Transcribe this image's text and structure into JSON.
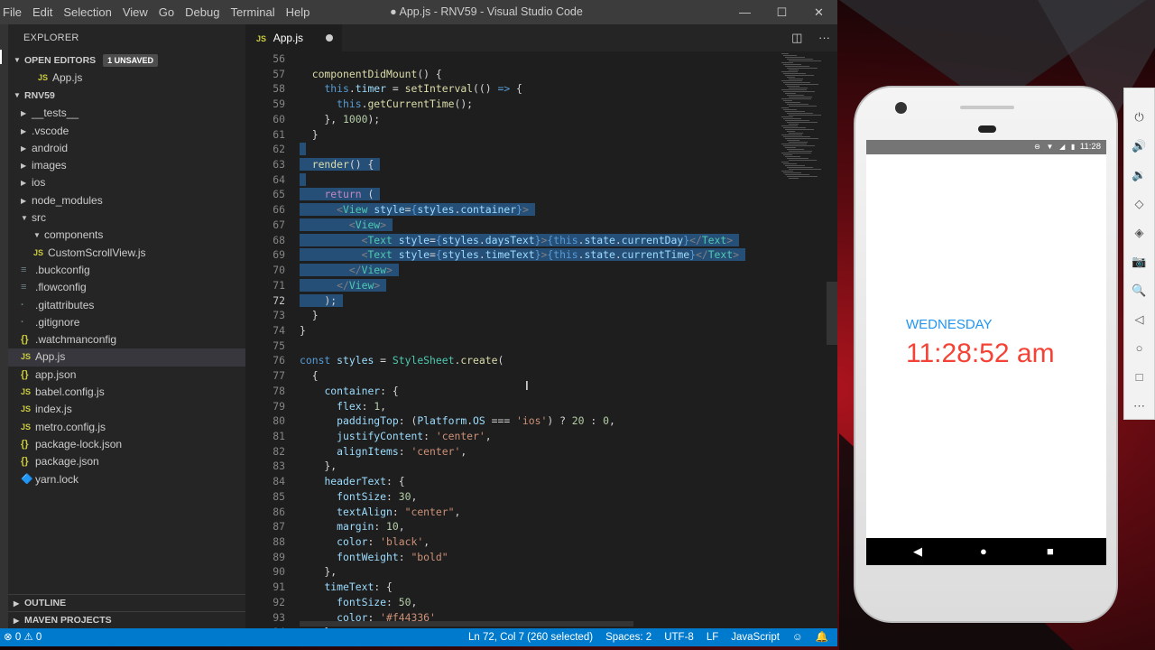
{
  "window": {
    "title": "● App.js - RNV59 - Visual Studio Code",
    "menu": [
      "File",
      "Edit",
      "Selection",
      "View",
      "Go",
      "Debug",
      "Terminal",
      "Help"
    ],
    "controls": [
      "—",
      "☐",
      "✕"
    ]
  },
  "sidebar": {
    "header": "EXPLORER",
    "open_editors": {
      "label": "OPEN EDITORS",
      "badge": "1 UNSAVED",
      "files": [
        {
          "icon": "JS",
          "name": "App.js"
        }
      ]
    },
    "project": {
      "label": "RNV59",
      "items": [
        {
          "type": "folder",
          "name": "__tests__",
          "depth": 1
        },
        {
          "type": "folder",
          "name": ".vscode",
          "depth": 1
        },
        {
          "type": "folder",
          "name": "android",
          "depth": 1
        },
        {
          "type": "folder",
          "name": "images",
          "depth": 1
        },
        {
          "type": "folder",
          "name": "ios",
          "depth": 1
        },
        {
          "type": "folder",
          "name": "node_modules",
          "depth": 1
        },
        {
          "type": "folder-open",
          "name": "src",
          "depth": 1
        },
        {
          "type": "folder-open",
          "name": "components",
          "depth": 2
        },
        {
          "type": "js",
          "icon": "JS",
          "name": "CustomScrollView.js",
          "depth": 3
        },
        {
          "type": "lines",
          "icon": "≡",
          "name": ".buckconfig",
          "depth": 1
        },
        {
          "type": "lines",
          "icon": "≡",
          "name": ".flowconfig",
          "depth": 1
        },
        {
          "type": "dot",
          "icon": "·",
          "name": ".gitattributes",
          "depth": 1
        },
        {
          "type": "dot",
          "icon": "·",
          "name": ".gitignore",
          "depth": 1
        },
        {
          "type": "json",
          "icon": "{}",
          "name": ".watchmanconfig",
          "depth": 1
        },
        {
          "type": "js",
          "icon": "JS",
          "name": "App.js",
          "depth": 1,
          "active": true
        },
        {
          "type": "json",
          "icon": "{}",
          "name": "app.json",
          "depth": 1
        },
        {
          "type": "js",
          "icon": "JS",
          "name": "babel.config.js",
          "depth": 1
        },
        {
          "type": "js",
          "icon": "JS",
          "name": "index.js",
          "depth": 1
        },
        {
          "type": "js",
          "icon": "JS",
          "name": "metro.config.js",
          "depth": 1
        },
        {
          "type": "json",
          "icon": "{}",
          "name": "package-lock.json",
          "depth": 1
        },
        {
          "type": "json",
          "icon": "{}",
          "name": "package.json",
          "depth": 1
        },
        {
          "type": "yarn",
          "icon": "🔷",
          "name": "yarn.lock",
          "depth": 1
        }
      ]
    },
    "bottom_sections": [
      "OUTLINE",
      "MAVEN PROJECTS"
    ]
  },
  "editor": {
    "tab": {
      "icon": "JS",
      "label": "App.js"
    },
    "line_numbers": [
      56,
      57,
      58,
      59,
      60,
      61,
      62,
      63,
      64,
      65,
      66,
      67,
      68,
      69,
      70,
      71,
      72,
      73,
      74,
      75,
      76,
      77,
      78,
      79,
      80,
      81,
      82,
      83,
      84,
      85,
      86,
      87,
      88,
      89,
      90,
      91,
      92,
      93,
      94
    ],
    "current_line": 72,
    "lines": [
      {
        "sel": false,
        "t": []
      },
      {
        "sel": false,
        "t": [
          [
            "",
            "  "
          ],
          [
            "fn",
            "componentDidMount"
          ],
          [
            "",
            "() {"
          ]
        ]
      },
      {
        "sel": false,
        "t": [
          [
            "",
            "    "
          ],
          [
            "kw",
            "this"
          ],
          [
            "",
            "."
          ],
          [
            "prop",
            "timer"
          ],
          [
            "",
            " = "
          ],
          [
            "fn",
            "setInterval"
          ],
          [
            "",
            "(() "
          ],
          [
            "kw",
            "=>"
          ],
          [
            "",
            " {"
          ]
        ]
      },
      {
        "sel": false,
        "t": [
          [
            "",
            "      "
          ],
          [
            "kw",
            "this"
          ],
          [
            "",
            "."
          ],
          [
            "fn",
            "getCurrentTime"
          ],
          [
            "",
            "();"
          ]
        ]
      },
      {
        "sel": false,
        "t": [
          [
            "",
            "    }, "
          ],
          [
            "num",
            "1000"
          ],
          [
            "",
            ");"
          ]
        ]
      },
      {
        "sel": false,
        "t": [
          [
            "",
            "  }"
          ]
        ]
      },
      {
        "sel": true,
        "t": [
          [
            "",
            ""
          ]
        ]
      },
      {
        "sel": true,
        "t": [
          [
            "",
            "  "
          ],
          [
            "fn",
            "render"
          ],
          [
            "",
            "() {"
          ]
        ]
      },
      {
        "sel": true,
        "t": [
          [
            "",
            ""
          ]
        ]
      },
      {
        "sel": true,
        "t": [
          [
            "",
            "    "
          ],
          [
            "ctl",
            "return"
          ],
          [
            "",
            " ("
          ]
        ]
      },
      {
        "sel": true,
        "t": [
          [
            "",
            "      "
          ],
          [
            "pun",
            "<"
          ],
          [
            "tag",
            "View"
          ],
          [
            "",
            " "
          ],
          [
            "prop",
            "style"
          ],
          [
            "",
            "="
          ],
          [
            "kw",
            "{"
          ],
          [
            "prop",
            "styles"
          ],
          [
            "",
            "."
          ],
          [
            "prop",
            "container"
          ],
          [
            "kw",
            "}"
          ],
          [
            "pun",
            ">"
          ]
        ]
      },
      {
        "sel": true,
        "t": [
          [
            "",
            "        "
          ],
          [
            "pun",
            "<"
          ],
          [
            "tag",
            "View"
          ],
          [
            "pun",
            ">"
          ]
        ]
      },
      {
        "sel": true,
        "t": [
          [
            "",
            "          "
          ],
          [
            "pun",
            "<"
          ],
          [
            "tag",
            "Text"
          ],
          [
            "",
            " "
          ],
          [
            "prop",
            "style"
          ],
          [
            "",
            "="
          ],
          [
            "kw",
            "{"
          ],
          [
            "prop",
            "styles"
          ],
          [
            "",
            "."
          ],
          [
            "prop",
            "daysText"
          ],
          [
            "kw",
            "}"
          ],
          [
            "pun",
            ">"
          ],
          [
            "kw",
            "{"
          ],
          [
            "kw",
            "this"
          ],
          [
            "",
            "."
          ],
          [
            "prop",
            "state"
          ],
          [
            "",
            "."
          ],
          [
            "prop",
            "currentDay"
          ],
          [
            "kw",
            "}"
          ],
          [
            "pun",
            "</"
          ],
          [
            "tag",
            "Text"
          ],
          [
            "pun",
            ">"
          ]
        ]
      },
      {
        "sel": true,
        "t": [
          [
            "",
            "          "
          ],
          [
            "pun",
            "<"
          ],
          [
            "tag",
            "Text"
          ],
          [
            "",
            " "
          ],
          [
            "prop",
            "style"
          ],
          [
            "",
            "="
          ],
          [
            "kw",
            "{"
          ],
          [
            "prop",
            "styles"
          ],
          [
            "",
            "."
          ],
          [
            "prop",
            "timeText"
          ],
          [
            "kw",
            "}"
          ],
          [
            "pun",
            ">"
          ],
          [
            "kw",
            "{"
          ],
          [
            "kw",
            "this"
          ],
          [
            "",
            "."
          ],
          [
            "prop",
            "state"
          ],
          [
            "",
            "."
          ],
          [
            "prop",
            "currentTime"
          ],
          [
            "kw",
            "}"
          ],
          [
            "pun",
            "</"
          ],
          [
            "tag",
            "Text"
          ],
          [
            "pun",
            ">"
          ]
        ]
      },
      {
        "sel": true,
        "t": [
          [
            "",
            "        "
          ],
          [
            "pun",
            "</"
          ],
          [
            "tag",
            "View"
          ],
          [
            "pun",
            ">"
          ]
        ]
      },
      {
        "sel": true,
        "t": [
          [
            "",
            "      "
          ],
          [
            "pun",
            "</"
          ],
          [
            "tag",
            "View"
          ],
          [
            "pun",
            ">"
          ]
        ]
      },
      {
        "sel": true,
        "t": [
          [
            "",
            "    );"
          ]
        ]
      },
      {
        "sel": false,
        "t": [
          [
            "",
            "  }"
          ]
        ]
      },
      {
        "sel": false,
        "t": [
          [
            "",
            "}"
          ]
        ]
      },
      {
        "sel": false,
        "t": []
      },
      {
        "sel": false,
        "t": [
          [
            "kw",
            "const"
          ],
          [
            "",
            " "
          ],
          [
            "prop",
            "styles"
          ],
          [
            "",
            " = "
          ],
          [
            "cls",
            "StyleSheet"
          ],
          [
            "",
            "."
          ],
          [
            "fn",
            "create"
          ],
          [
            "",
            "("
          ]
        ]
      },
      {
        "sel": false,
        "t": [
          [
            "",
            "  {"
          ]
        ]
      },
      {
        "sel": false,
        "t": [
          [
            "",
            "    "
          ],
          [
            "prop",
            "container"
          ],
          [
            "",
            ": {"
          ]
        ]
      },
      {
        "sel": false,
        "t": [
          [
            "",
            "      "
          ],
          [
            "prop",
            "flex"
          ],
          [
            "",
            ": "
          ],
          [
            "num",
            "1"
          ],
          [
            "",
            ","
          ]
        ]
      },
      {
        "sel": false,
        "t": [
          [
            "",
            "      "
          ],
          [
            "prop",
            "paddingTop"
          ],
          [
            "",
            ": ("
          ],
          [
            "prop",
            "Platform"
          ],
          [
            "",
            "."
          ],
          [
            "prop",
            "OS"
          ],
          [
            "",
            " === "
          ],
          [
            "str",
            "'ios'"
          ],
          [
            "",
            ") ? "
          ],
          [
            "num",
            "20"
          ],
          [
            "",
            " : "
          ],
          [
            "num",
            "0"
          ],
          [
            "",
            ","
          ]
        ]
      },
      {
        "sel": false,
        "t": [
          [
            "",
            "      "
          ],
          [
            "prop",
            "justifyContent"
          ],
          [
            "",
            ": "
          ],
          [
            "str",
            "'center'"
          ],
          [
            "",
            ","
          ]
        ]
      },
      {
        "sel": false,
        "t": [
          [
            "",
            "      "
          ],
          [
            "prop",
            "alignItems"
          ],
          [
            "",
            ": "
          ],
          [
            "str",
            "'center'"
          ],
          [
            "",
            ","
          ]
        ]
      },
      {
        "sel": false,
        "t": [
          [
            "",
            "    },"
          ]
        ]
      },
      {
        "sel": false,
        "t": [
          [
            "",
            "    "
          ],
          [
            "prop",
            "headerText"
          ],
          [
            "",
            ": {"
          ]
        ]
      },
      {
        "sel": false,
        "t": [
          [
            "",
            "      "
          ],
          [
            "prop",
            "fontSize"
          ],
          [
            "",
            ": "
          ],
          [
            "num",
            "30"
          ],
          [
            "",
            ","
          ]
        ]
      },
      {
        "sel": false,
        "t": [
          [
            "",
            "      "
          ],
          [
            "prop",
            "textAlign"
          ],
          [
            "",
            ": "
          ],
          [
            "str",
            "\"center\""
          ],
          [
            "",
            ","
          ]
        ]
      },
      {
        "sel": false,
        "t": [
          [
            "",
            "      "
          ],
          [
            "prop",
            "margin"
          ],
          [
            "",
            ": "
          ],
          [
            "num",
            "10"
          ],
          [
            "",
            ","
          ]
        ]
      },
      {
        "sel": false,
        "t": [
          [
            "",
            "      "
          ],
          [
            "prop",
            "color"
          ],
          [
            "",
            ": "
          ],
          [
            "str",
            "'black'"
          ],
          [
            "",
            ","
          ]
        ]
      },
      {
        "sel": false,
        "t": [
          [
            "",
            "      "
          ],
          [
            "prop",
            "fontWeight"
          ],
          [
            "",
            ": "
          ],
          [
            "str",
            "\"bold\""
          ]
        ]
      },
      {
        "sel": false,
        "t": [
          [
            "",
            "    },"
          ]
        ]
      },
      {
        "sel": false,
        "t": [
          [
            "",
            "    "
          ],
          [
            "prop",
            "timeText"
          ],
          [
            "",
            ": {"
          ]
        ]
      },
      {
        "sel": false,
        "t": [
          [
            "",
            "      "
          ],
          [
            "prop",
            "fontSize"
          ],
          [
            "",
            ": "
          ],
          [
            "num",
            "50"
          ],
          [
            "",
            ","
          ]
        ]
      },
      {
        "sel": false,
        "t": [
          [
            "",
            "      "
          ],
          [
            "prop",
            "color"
          ],
          [
            "",
            ": "
          ],
          [
            "str",
            "'#f44336'"
          ]
        ]
      },
      {
        "sel": false,
        "t": [
          [
            "",
            "    },"
          ]
        ]
      }
    ]
  },
  "statusbar": {
    "left": "⊗ 0 ⚠ 0",
    "items": [
      "Ln 72, Col 7 (260 selected)",
      "Spaces: 2",
      "UTF-8",
      "LF",
      "JavaScript",
      "☺",
      "🔔"
    ]
  },
  "emulator": {
    "status_time": "11:28",
    "day": "WEDNESDAY",
    "time": "11:28:52 am",
    "day_color": "#2196f3",
    "time_color": "#f44336",
    "nav": [
      "◀",
      "●",
      "■"
    ],
    "tools": [
      "⏻",
      "🔊",
      "🔉",
      "◇",
      "◈",
      "📷",
      "🔍",
      "◁",
      "○",
      "□",
      "⋯"
    ]
  },
  "colors": {
    "accent": "#007acc",
    "selection": "#264f78"
  }
}
